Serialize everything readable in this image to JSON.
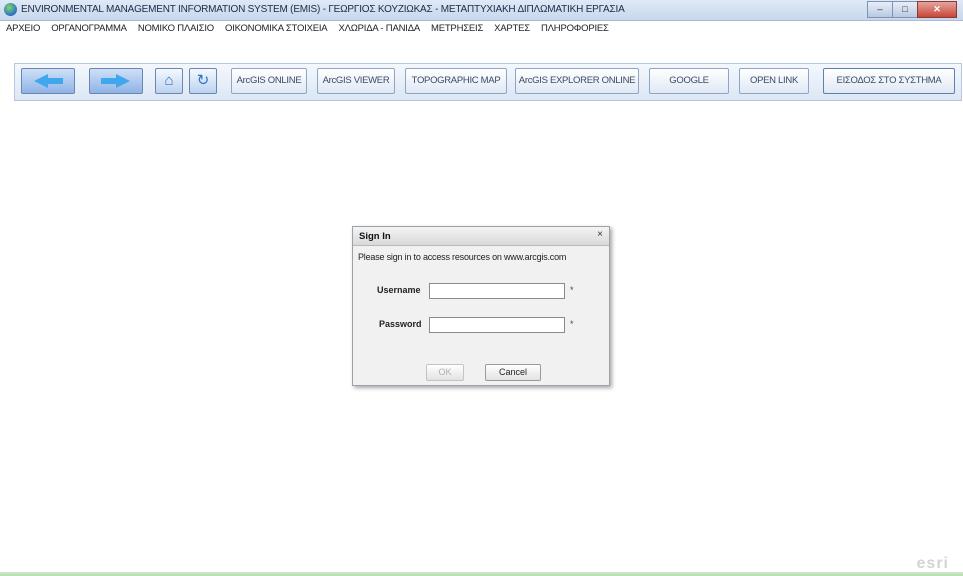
{
  "window": {
    "title": "ENVIRONMENTAL MANAGEMENT INFORMATION SYSTEM (EMIS) - ΓΕΩΡΓΙΟΣ ΚΟΥΖΙΩΚΑΣ - ΜΕΤΑΠΤΥΧΙΑΚΗ ΔΙΠΛΩΜΑΤΙΚΗ ΕΡΓΑΣΙΑ",
    "minimize": "–",
    "maximize": "□",
    "close": "✕"
  },
  "menu": [
    "ΑΡΧΕΙΟ",
    "ΟΡΓΑΝΟΓΡΑΜΜΑ",
    "ΝΟΜΙΚΟ ΠΛΑΙΣΙΟ",
    "ΟΙΚΟΝΟΜΙΚΑ ΣΤΟΙΧΕΙΑ",
    "ΧΛΩΡΙΔΑ - ΠΑΝΙΔΑ",
    "ΜΕΤΡΗΣΕΙΣ",
    "ΧΑΡΤΕΣ",
    "ΠΛΗΡΟΦΟΡΙΕΣ"
  ],
  "toolbar": {
    "home_icon": "⌂",
    "refresh_icon": "↻",
    "buttons": [
      "ArcGIS ONLINE",
      "ArcGIS VIEWER",
      "TOPOGRAPHIC MAP",
      "ArcGIS EXPLORER ONLINE",
      "GOOGLE",
      "OPEN LINK",
      "ΕΙΣΟΔΟΣ ΣΤΟ ΣΥΣΤΗΜΑ"
    ]
  },
  "dialog": {
    "title": "Sign In",
    "close": "×",
    "message": "Please sign in to access resources on www.arcgis.com",
    "username_label": "Username",
    "username_value": "",
    "password_label": "Password",
    "password_value": "",
    "required_mark": "*",
    "ok_label": "OK",
    "cancel_label": "Cancel"
  },
  "watermark": "esri"
}
